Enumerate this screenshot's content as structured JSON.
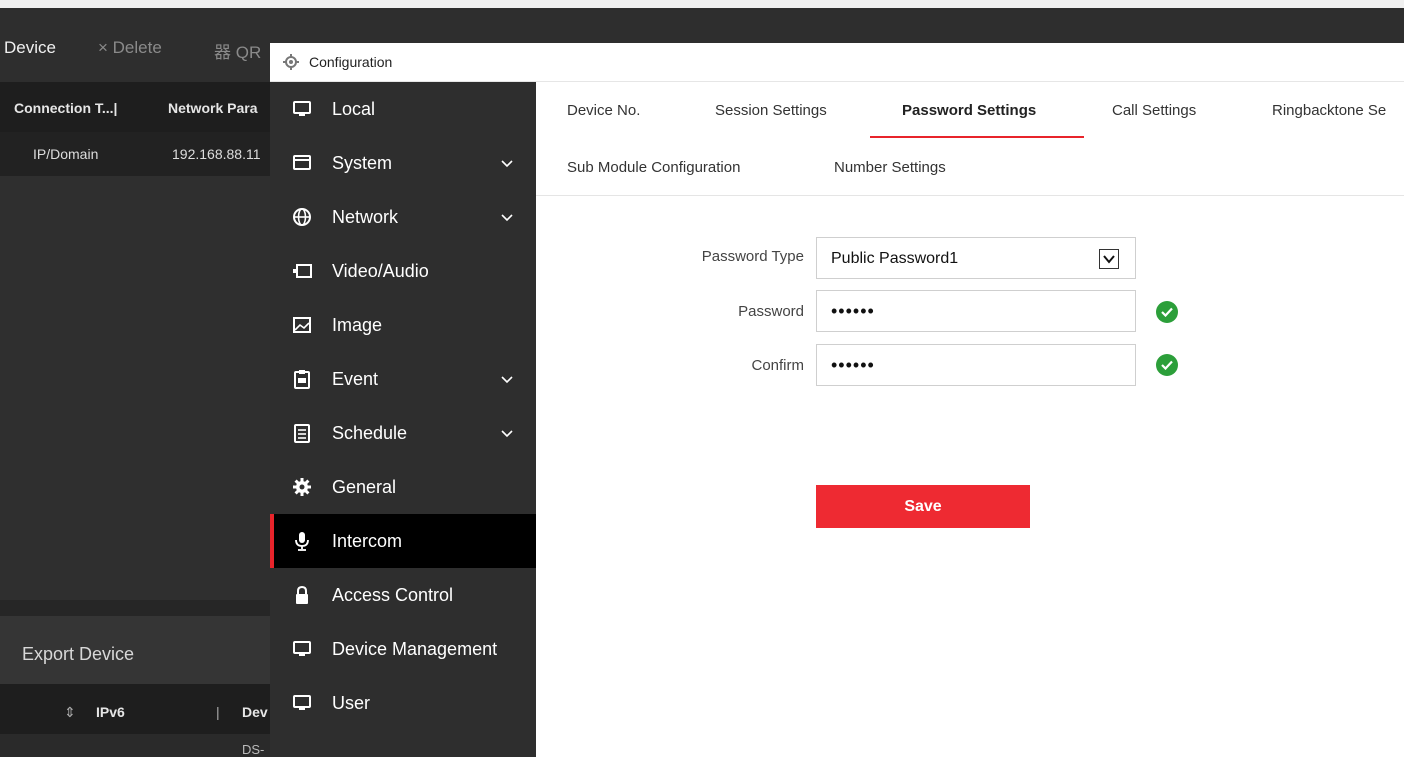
{
  "background": {
    "toolbar": {
      "device": "Device",
      "delete": "× Delete",
      "qr": "器 QR"
    },
    "table_headers": [
      "Connection T...|",
      "Network Para"
    ],
    "row": [
      "IP/Domain",
      "192.168.88.11"
    ],
    "export_title": "Export Device",
    "export_headers": [
      "IPv6",
      "Dev"
    ],
    "export_row": "DS-"
  },
  "window": {
    "title": "Configuration"
  },
  "sidebar": {
    "items": [
      {
        "label": "Local",
        "icon": "monitor-icon",
        "expandable": false
      },
      {
        "label": "System",
        "icon": "system-icon",
        "expandable": true
      },
      {
        "label": "Network",
        "icon": "globe-icon",
        "expandable": true
      },
      {
        "label": "Video/Audio",
        "icon": "video-icon",
        "expandable": false
      },
      {
        "label": "Image",
        "icon": "image-icon",
        "expandable": false
      },
      {
        "label": "Event",
        "icon": "clipboard-icon",
        "expandable": true
      },
      {
        "label": "Schedule",
        "icon": "calendar-icon",
        "expandable": true
      },
      {
        "label": "General",
        "icon": "gear-icon",
        "expandable": false
      },
      {
        "label": "Intercom",
        "icon": "microphone-icon",
        "expandable": false,
        "active": true
      },
      {
        "label": "Access Control",
        "icon": "lock-icon",
        "expandable": false
      },
      {
        "label": "Device Management",
        "icon": "monitor-icon",
        "expandable": false
      },
      {
        "label": "User",
        "icon": "monitor-icon",
        "expandable": false
      }
    ]
  },
  "tabs": {
    "row1": [
      "Device No.",
      "Session Settings",
      "Password Settings",
      "Call Settings",
      "Ringbacktone Se"
    ],
    "row2": [
      "Sub Module Configuration",
      "Number Settings"
    ],
    "active": "Password Settings"
  },
  "form": {
    "password_type_label": "Password Type",
    "password_type_value": "Public Password1",
    "password_label": "Password",
    "password_value": "••••••",
    "confirm_label": "Confirm",
    "confirm_value": "••••••",
    "save_label": "Save"
  },
  "colors": {
    "accent": "#e8242b",
    "sidebar_bg": "#2e2e2e",
    "active_bg": "#000000",
    "ok": "#2c9f3a"
  }
}
